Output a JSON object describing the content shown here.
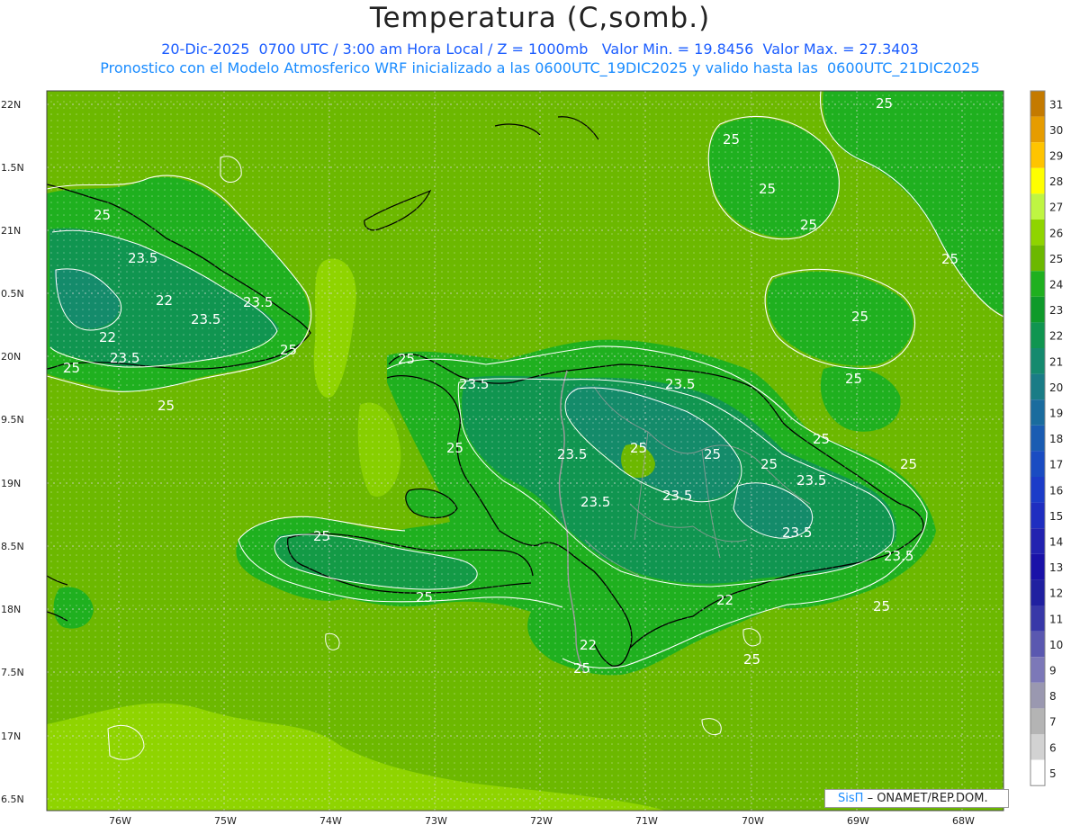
{
  "header": {
    "title": "Temperatura (C,somb.)",
    "line1": "20-Dic-2025  0700 UTC / 3:00 am Hora Local / Z = 1000mb   Valor Min. = 19.8456  Valor Max. = 27.3403",
    "line2": "Pronostico con el Modelo Atmosferico WRF inicializado a las 0600UTC_19DIC2025 y valido hasta las  0600UTC_21DIC2025"
  },
  "axes": {
    "lat_labels": [
      "22N",
      "1.5N",
      "21N",
      "0.5N",
      "20N",
      "9.5N",
      "19N",
      "8.5N",
      "18N",
      "7.5N",
      "17N",
      "6.5N"
    ],
    "lon_labels": [
      "76W",
      "75W",
      "74W",
      "73W",
      "72W",
      "71W",
      "70W",
      "69W",
      "68W"
    ]
  },
  "contour_labels": [
    "25",
    "25",
    "25",
    "25",
    "25",
    "25",
    "25",
    "25",
    "25",
    "25",
    "25",
    "25",
    "25",
    "25",
    "25",
    "25",
    "25",
    "25",
    "23.5",
    "23.5",
    "23.5",
    "23.5",
    "23.5",
    "23.5",
    "23.5",
    "23.5",
    "23.5",
    "23.5",
    "23.5",
    "23.5",
    "22",
    "22",
    "22",
    "22",
    "25",
    "25",
    "25",
    "25",
    "25"
  ],
  "colorbar": {
    "labels": [
      "31",
      "30",
      "29",
      "28",
      "27",
      "26",
      "25",
      "24",
      "23",
      "22",
      "21",
      "20",
      "19",
      "18",
      "17",
      "16",
      "15",
      "14",
      "13",
      "12",
      "11",
      "10",
      "9",
      "8",
      "7",
      "6",
      "5"
    ],
    "colors": [
      "#c47a00",
      "#e69c00",
      "#ffc400",
      "#ffff00",
      "#bff542",
      "#8fd400",
      "#6cb800",
      "#1fb01f",
      "#0f9a2a",
      "#109550",
      "#158a6e",
      "#1a7c86",
      "#1a6c9e",
      "#1a5cb2",
      "#1a4cc2",
      "#1c3cc8",
      "#1f2ec0",
      "#2222b0",
      "#1a12a8",
      "#2020a0",
      "#3838a8",
      "#5a58b0",
      "#7c78b8",
      "#9a98b0",
      "#b4b4b4",
      "#d2d2d2",
      "#ffffff"
    ]
  },
  "credit": {
    "brand": "SisΠ",
    "org": "– ONAMET/REP.DOM."
  }
}
